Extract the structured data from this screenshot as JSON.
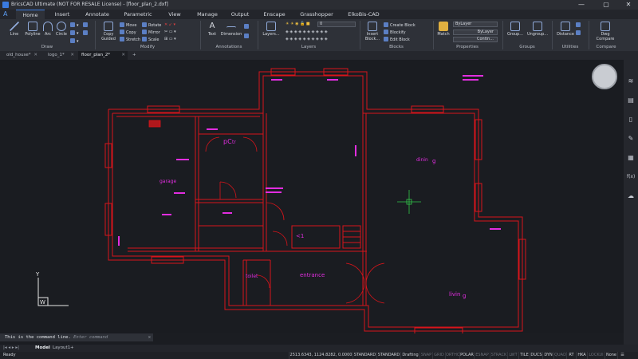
{
  "window": {
    "title": "BricsCAD Ultimate (NOT FOR RESALE License) - [floor_plan_2.dxf]",
    "minimize": "—",
    "maximize": "▢",
    "close": "✕"
  },
  "ribbon_tabs": [
    "Home",
    "Insert",
    "Annotate",
    "Parametric",
    "View",
    "Manage",
    "Output",
    "Enscape",
    "Grasshopper",
    "ElkoBis-CAD"
  ],
  "ribbon": {
    "draw": {
      "label": "Draw",
      "tools": [
        "Line",
        "Polyline",
        "Arc",
        "Circle"
      ]
    },
    "modify": {
      "label": "Modify",
      "copy_guided": "Copy Guided",
      "items": [
        "Move",
        "Copy",
        "Stretch",
        "Rotate",
        "Mirror",
        "Scale"
      ]
    },
    "annotations": {
      "label": "Annotations",
      "tools": [
        "Text",
        "Dimension"
      ]
    },
    "layers": {
      "label": "Layers",
      "tool": "Layers...",
      "current": "0"
    },
    "blocks": {
      "label": "Blocks",
      "insert": "Insert Block...",
      "items": [
        "Create Block",
        "Blockify",
        "Edit Block"
      ]
    },
    "properties": {
      "label": "Properties",
      "match": "Match",
      "color": "ByLayer",
      "lineweight": "ByLayer",
      "linetype": "Contin..."
    },
    "groups": {
      "label": "Groups",
      "items": [
        "Group...",
        "Ungroup..."
      ]
    },
    "utilities": {
      "label": "Utilities",
      "distance": "Distance"
    },
    "compare": {
      "label": "Compare",
      "dwg_compare": "Dwg Compare"
    }
  },
  "doc_tabs": [
    {
      "label": "old_house*"
    },
    {
      "label": "logo_1*"
    },
    {
      "label": "floor_plan_2*",
      "active": true
    }
  ],
  "drawing": {
    "rooms": [
      "garage",
      "pC",
      "tr",
      "dinin",
      "g",
      "<1",
      "toilet",
      "entrance",
      "livin",
      "g"
    ],
    "ucs": {
      "x": "W",
      "y": "Y"
    }
  },
  "right_panel_icons": [
    "layers-icon",
    "properties-icon",
    "bookmark-icon",
    "pen-icon",
    "blocks-icon",
    "fx-icon",
    "cloud-icon"
  ],
  "command_line": {
    "text": "This is the command line.",
    "placeholder": "Enter command"
  },
  "layout_tabs": [
    "Model",
    "Layout1",
    "+"
  ],
  "status": {
    "ready": "Ready",
    "coords": "2513.6343, 1124.8282, 0.0000",
    "toggles": [
      "STANDARD",
      "STANDARD",
      "Drafting",
      "SNAP",
      "GRID",
      "ORTHO",
      "POLAR",
      "ESNAP",
      "STRACK",
      "LWT",
      "TILE",
      "DUCS",
      "DYN",
      "QUAD",
      "RT",
      "HKA",
      "LOCKUI",
      "None"
    ],
    "off_toggles": [
      "SNAP",
      "GRID",
      "ORTHO",
      "ESNAP",
      "STRACK",
      "LWT",
      "QUAD",
      "LOCKUI"
    ]
  },
  "colors": {
    "wall": "#d8141a",
    "annotation": "#e22de0",
    "accent": "#3a7be0",
    "background": "#1a1c21"
  }
}
